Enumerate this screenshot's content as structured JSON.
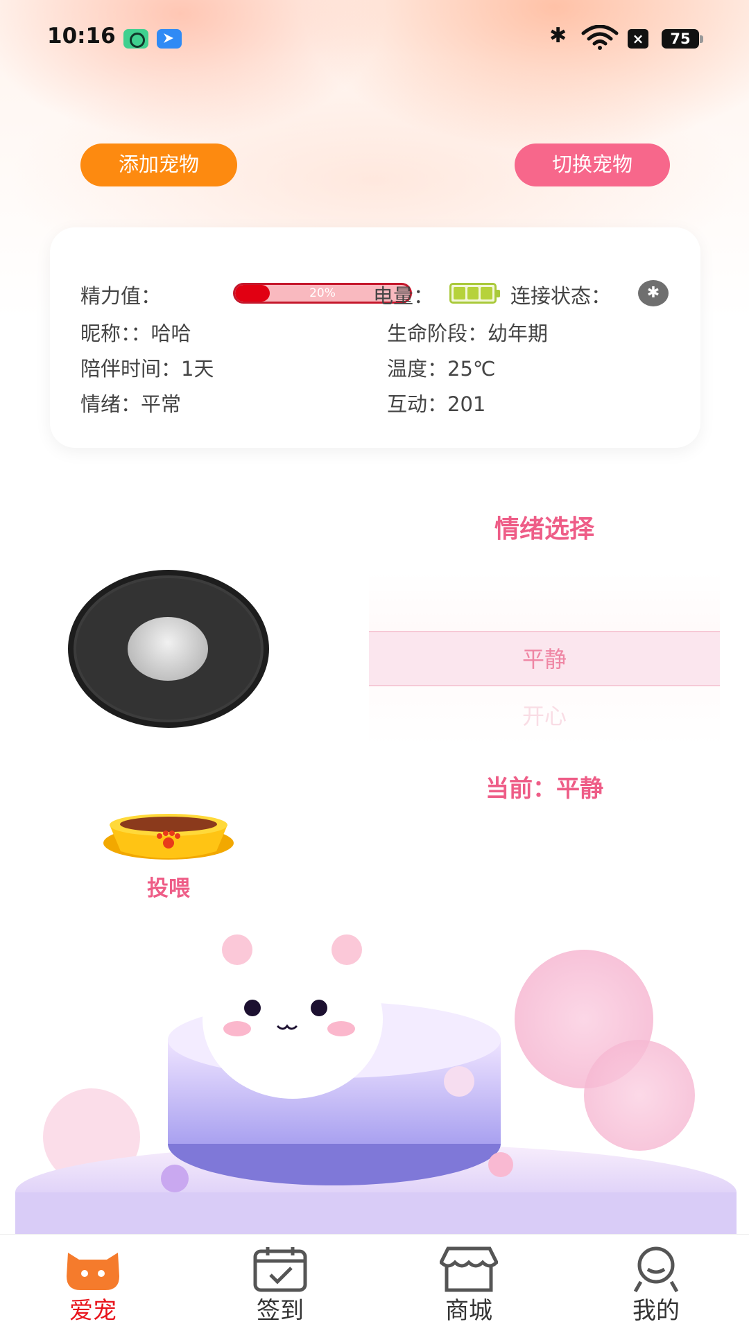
{
  "status_bar": {
    "time": "10:16",
    "battery": "75"
  },
  "buttons": {
    "add_pet": "添加宠物",
    "switch_pet": "切换宠物"
  },
  "info": {
    "energy_label": "精力值：",
    "energy_value": "20%",
    "energy_fraction": 0.2,
    "power_label": "电量：",
    "connection_label": "连接状态：",
    "nickname": "昵称：：哈哈",
    "life_stage": "生命阶段：幼年期",
    "companion_time": "陪伴时间：1天",
    "temperature": "温度：25℃",
    "mood": "情绪：平常",
    "interaction": "互动：201"
  },
  "emotion": {
    "title": "情绪选择",
    "options": [
      "平静",
      "开心"
    ],
    "selected": "平静",
    "current_label": "当前：平静"
  },
  "feed": {
    "label": "投喂"
  },
  "tabs": [
    {
      "label": "爱宠",
      "icon": "cat-face-icon",
      "active": true
    },
    {
      "label": "签到",
      "icon": "calendar-check-icon",
      "active": false
    },
    {
      "label": "商城",
      "icon": "store-icon",
      "active": false
    },
    {
      "label": "我的",
      "icon": "user-icon",
      "active": false
    }
  ],
  "colors": {
    "orange": "#fd8a10",
    "pink": "#f7678b",
    "accent_text": "#ee5d87",
    "active_tab": "#e8141c"
  }
}
